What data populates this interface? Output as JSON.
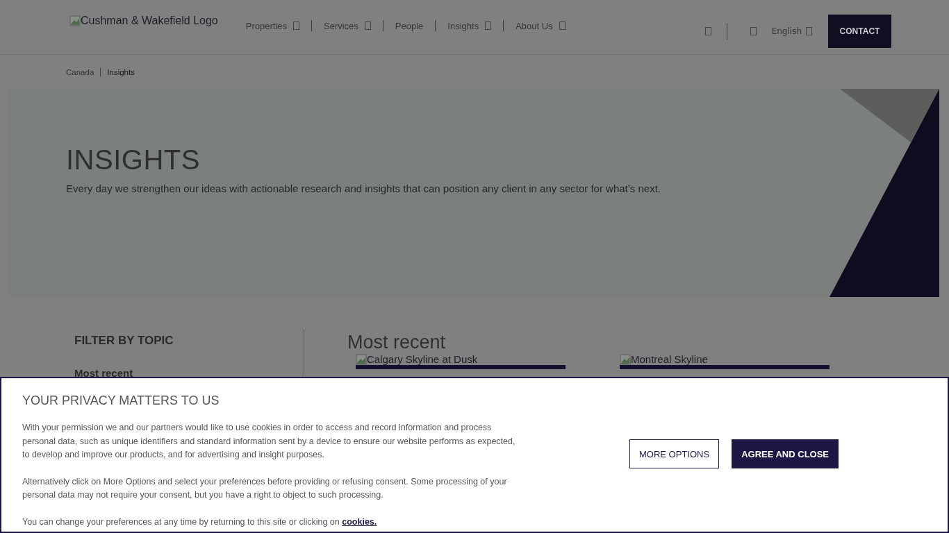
{
  "header": {
    "logo_alt": "Cushman & Wakefield Logo",
    "nav": [
      {
        "label": "Properties",
        "has_dropdown": true
      },
      {
        "label": "Services",
        "has_dropdown": true
      },
      {
        "label": "People",
        "has_dropdown": false
      },
      {
        "label": "Insights",
        "has_dropdown": true
      },
      {
        "label": "About Us",
        "has_dropdown": true
      }
    ],
    "language": "English",
    "contact": "CONTACT"
  },
  "breadcrumb": [
    "Canada",
    "Insights"
  ],
  "hero": {
    "title": "INSIGHTS",
    "subtitle": "Every day we strengthen our ideas with actionable research and insights that can position any client in any sector for what’s next."
  },
  "filter": {
    "heading": "FILTER BY TOPIC",
    "items": [
      "Most recent"
    ]
  },
  "main": {
    "heading": "Most recent",
    "cards": [
      {
        "image_alt": "Calgary Skyline at Dusk"
      },
      {
        "image_alt": "Montreal Skyline"
      }
    ]
  },
  "cookie_banner": {
    "title": "YOUR PRIVACY MATTERS TO US",
    "paragraphs": [
      "With your permission we and our partners would like to use cookies in order to access and record information and process personal data, such as unique identifiers and standard information sent by a device to ensure our website performs as expected, to develop and improve our products, and for advertising and insight purposes.",
      "Alternatively click on More Options and select your preferences before providing or refusing consent. Some processing of your personal data may not require your consent, but you have a right to object to such processing."
    ],
    "footer_text": "You can change your preferences at any time by returning to this site or clicking on",
    "footer_link": "cookies.",
    "buttons": [
      "MORE OPTIONS",
      "AGREE AND CLOSE"
    ]
  }
}
